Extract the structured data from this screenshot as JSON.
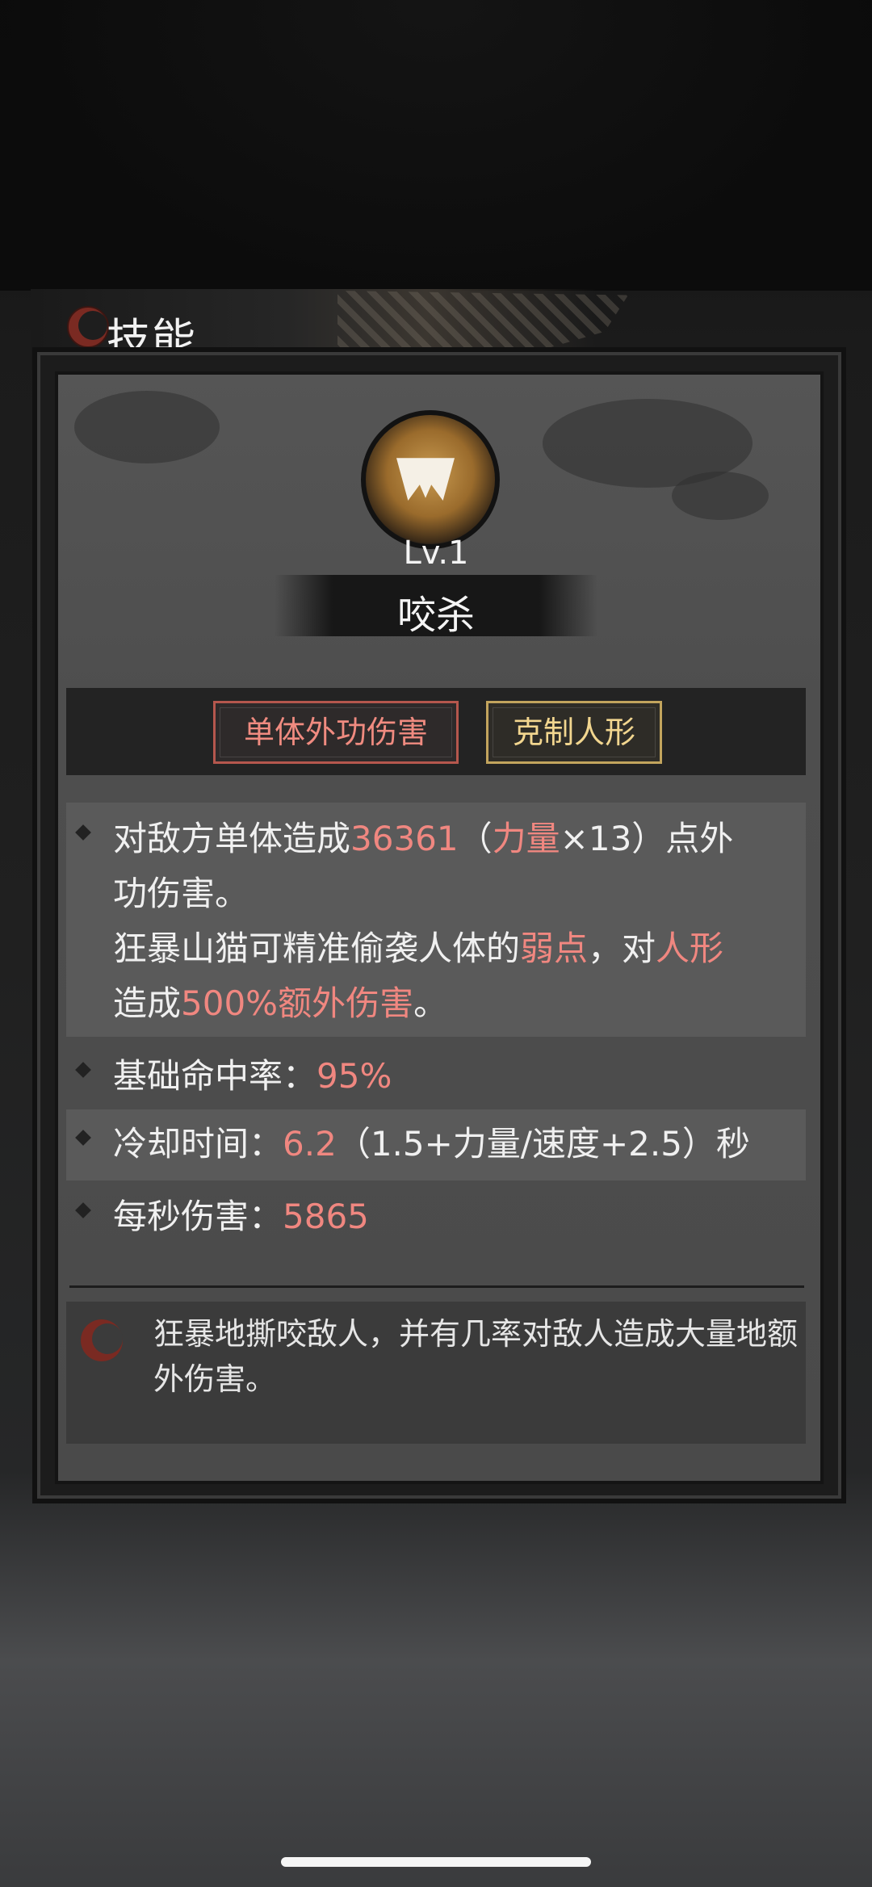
{
  "title": "技能",
  "skill": {
    "level": "Lv.1",
    "name": "咬杀"
  },
  "tags": [
    {
      "label": "单体外功伤害",
      "color": "#f08b80"
    },
    {
      "label": "克制人形",
      "color": "#f2d68f"
    }
  ],
  "description": {
    "line1_pre": "对敌方单体造成",
    "line1_value": "36361",
    "line1_paren_open": "（",
    "line1_stat": "力量",
    "line1_mult": "×13）点外",
    "line2": "功伤害。",
    "line3_pre": "狂暴山猫可精准偷袭人体的",
    "line3_weak": "弱点",
    "line3_mid": "，对",
    "line3_target": "人形",
    "line4_pre": "造成",
    "line4_bonus": "500%额外伤害",
    "line4_post": "。"
  },
  "stats": {
    "hit_label": "基础命中率：",
    "hit_value": "95%",
    "cooldown_label": "冷却时间：",
    "cooldown_value": "6.2",
    "cooldown_formula": "（1.5+力量/速度+2.5）秒",
    "dps_label": "每秒伤害：",
    "dps_value": "5865"
  },
  "flavor": "狂暴地撕咬敌人，并有几率对敌人造成大量地额外伤害。",
  "colors": {
    "accent_red": "#f08780",
    "accent_gold": "#f2d68f"
  }
}
